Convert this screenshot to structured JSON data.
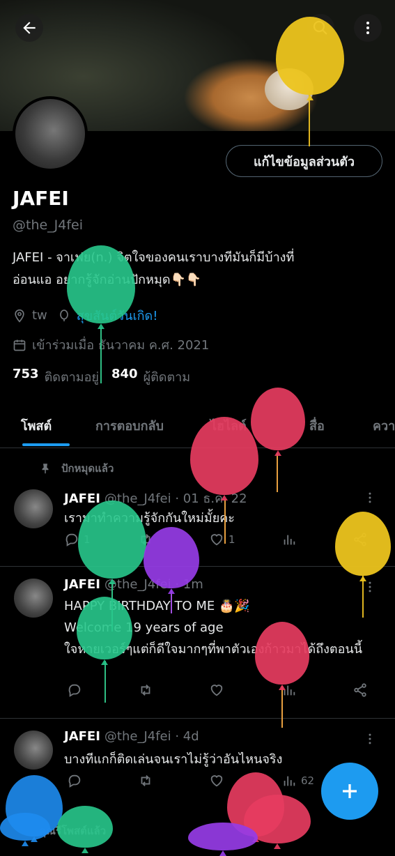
{
  "header": {
    "back_icon": "arrow-left-icon",
    "search_icon": "search-icon",
    "more_icon": "more-vertical-icon"
  },
  "profile": {
    "edit_button": "แก้ไขข้อมูลส่วนตัว",
    "name": "JAFEI",
    "handle": "@the_J4fei",
    "bio_line1": "JAFEI - จาเฟย(n.) จิตใจของคนเราบางทีมันก็มีบ้างที่",
    "bio_line2": "อ่อนแอ อยากรู้จักอ่านปักหมุด👇🏻👇🏻",
    "location": "tw",
    "birthday_link": "สุขสันต์วันเกิด!",
    "joined": "เข้าร่วมเมื่อ ธันวาคม ค.ศ. 2021",
    "following_count": "753",
    "following_label": "ติดตามอยู่",
    "followers_count": "840",
    "followers_label": "ผู้ติดตาม"
  },
  "tabs": [
    "โพสต์",
    "การตอบกลับ",
    "ไฮไลต์",
    "สื่อ",
    "ควา"
  ],
  "pinned_label": "ปักหมุดแล้ว",
  "tweets": [
    {
      "name": "JAFEI",
      "meta": "@the_J4fei · 01 ธ.ค. 22",
      "line1": "เรามาทำความรู้จักกันใหม่มั้ยคะ",
      "line2": "",
      "line3": "",
      "reply_count": "1",
      "like_count": "1",
      "views": ""
    },
    {
      "name": "JAFEI",
      "meta": "@the_J4fei · 1m",
      "line1": "HAPPY BIRTHDAY TO ME 🎂🎉",
      "line2": "Welcome 19 years of age",
      "line3": "ใจหายเวอร์ๆแต่ก็ดีใจมากๆที่พาตัวเองก้าวมาได้ถึงตอนนี้",
      "reply_count": "",
      "like_count": "",
      "views": ""
    },
    {
      "name": "JAFEI",
      "meta": "@the_J4fei · 4d",
      "line1": "บางทีแกก็ติดเล่นจนเราไม่รู้ว่าอันไหนจริง",
      "line2": "",
      "line3": "",
      "reply_count": "",
      "like_count": "",
      "views": "62"
    }
  ],
  "retweeted_label": "คุณรีโพสต์แล้ว",
  "fab_icon": "plus-icon",
  "colors": {
    "accent": "#1d9bf0",
    "bg": "#000000",
    "muted": "#71767b"
  }
}
